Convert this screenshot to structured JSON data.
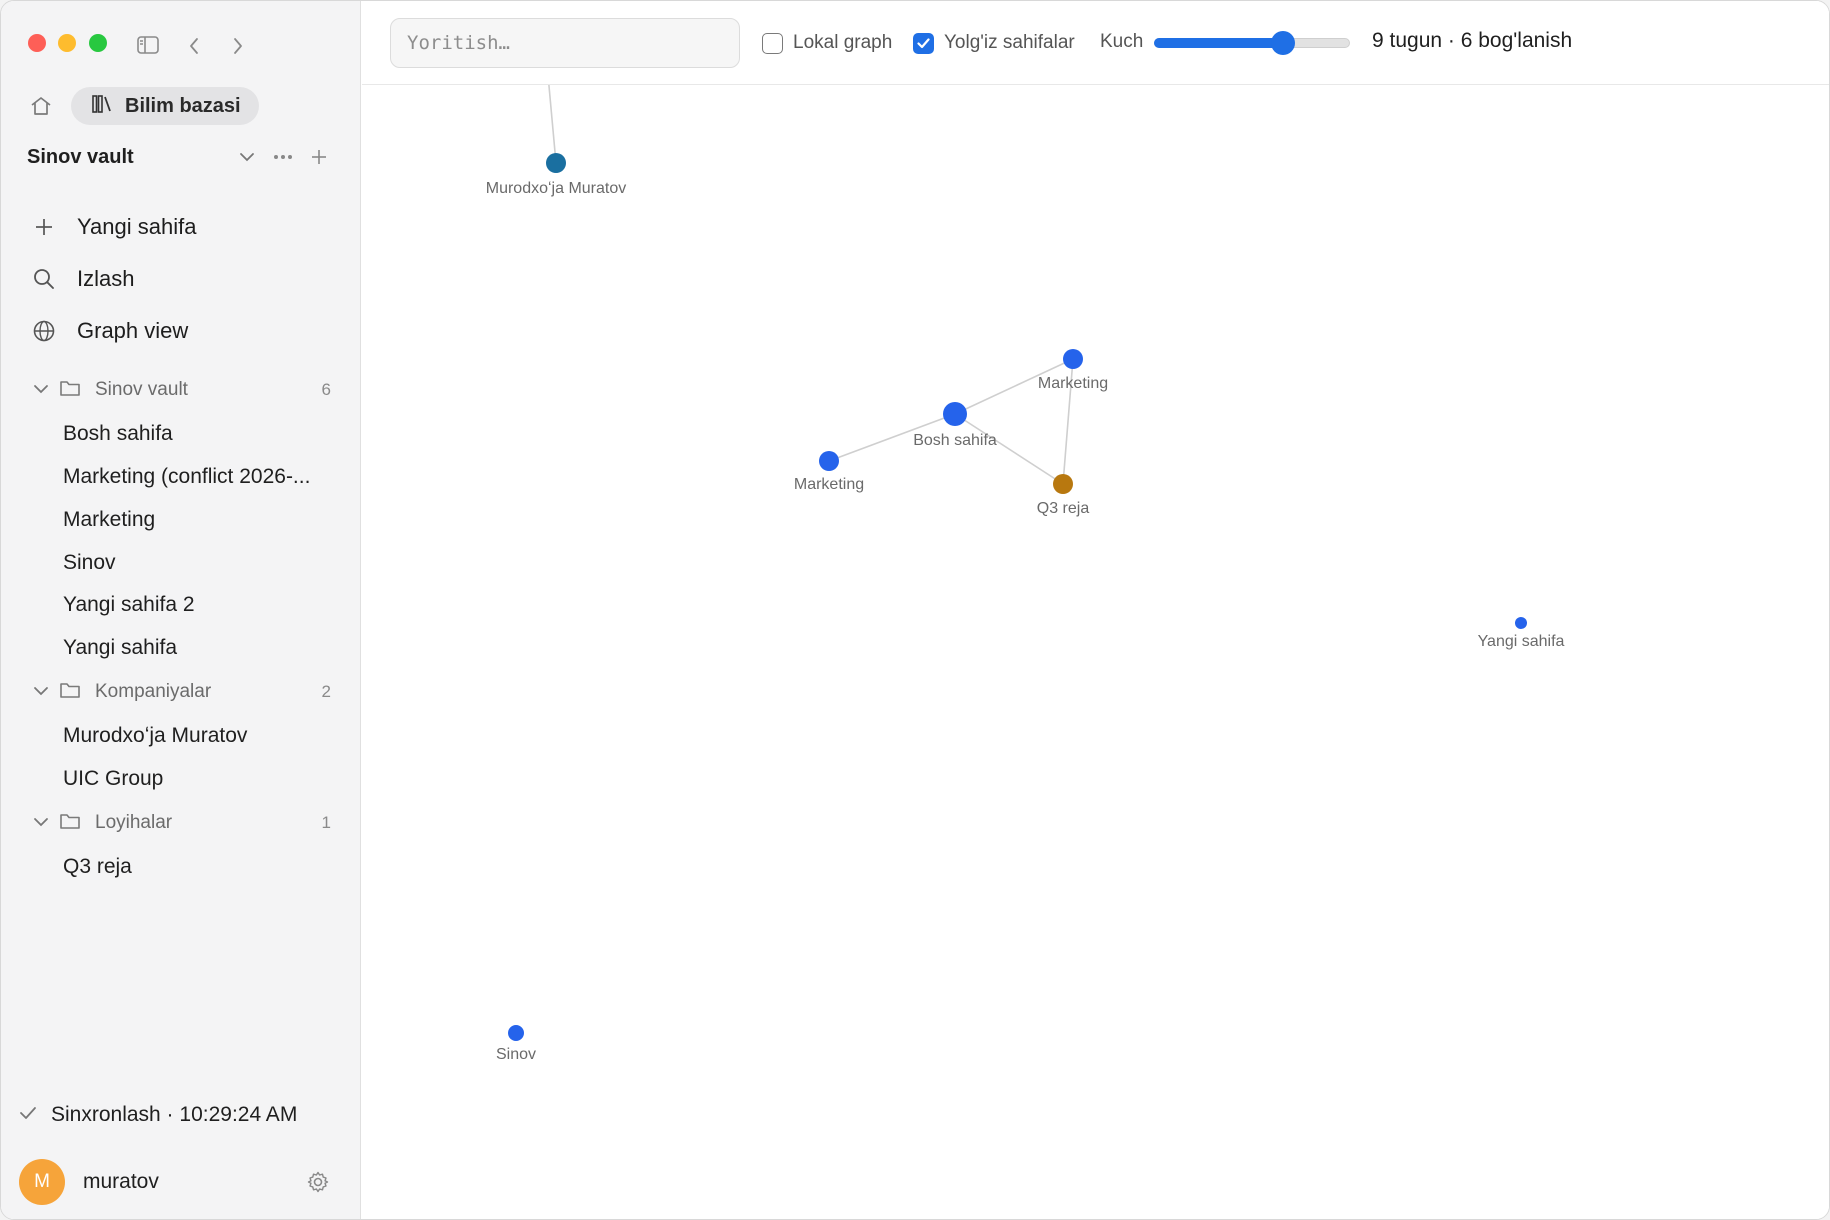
{
  "sidebar": {
    "kb_label": "Bilim bazasi",
    "vault_name": "Sinov vault",
    "nav": [
      {
        "label": "Yangi sahifa",
        "icon": "plus-icon"
      },
      {
        "label": "Izlash",
        "icon": "search-icon"
      },
      {
        "label": "Graph view",
        "icon": "globe-icon"
      }
    ],
    "folders": [
      {
        "name": "Sinov vault",
        "count": "6",
        "files": [
          "Bosh sahifa",
          "Marketing (conflict 2026-...",
          "Marketing",
          "Sinov",
          "Yangi sahifa 2",
          "Yangi sahifa"
        ]
      },
      {
        "name": "Kompaniyalar",
        "count": "2",
        "files": [
          "Murodxoʻja Muratov",
          "UIC Group"
        ]
      },
      {
        "name": "Loyihalar",
        "count": "1",
        "files": [
          "Q3 reja"
        ]
      }
    ],
    "sync_status": "Sinxronlash · 10:29:24 AM",
    "user": {
      "initial": "M",
      "name": "muratov",
      "avatar_color": "#f6a43a"
    }
  },
  "toolbar": {
    "search_placeholder": "Yoritish…",
    "local_graph": {
      "label": "Lokal graph",
      "checked": false
    },
    "orphans": {
      "label": "Yolg'iz sahifalar",
      "checked": true
    },
    "strength_label": "Kuch",
    "strength_value": 0.68,
    "stats": "9 tugun · 6 bog'lanish"
  },
  "colors": {
    "accent": "#1f6fe5",
    "node_default": "#2563eb",
    "node_company": "#1a6fa0",
    "node_project": "#b8780f",
    "edge": "#cfcfcf"
  },
  "graph": {
    "nodes": [
      {
        "id": "murod",
        "label": "Murodxoʻja Muratov",
        "kind": "company"
      },
      {
        "id": "marketing2",
        "label": "Marketing",
        "kind": "page"
      },
      {
        "id": "bosh",
        "label": "Bosh sahifa",
        "kind": "page"
      },
      {
        "id": "marketing1",
        "label": "Marketing",
        "kind": "page"
      },
      {
        "id": "q3",
        "label": "Q3 reja",
        "kind": "project"
      },
      {
        "id": "yangi",
        "label": "Yangi sahifa",
        "kind": "page"
      },
      {
        "id": "sinov",
        "label": "Sinov",
        "kind": "page"
      }
    ],
    "edges": [
      [
        "marketing1",
        "bosh"
      ],
      [
        "bosh",
        "marketing2"
      ],
      [
        "bosh",
        "q3"
      ],
      [
        "marketing2",
        "q3"
      ],
      [
        "murod",
        "offscreen"
      ]
    ]
  }
}
